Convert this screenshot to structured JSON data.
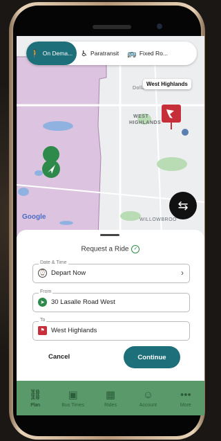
{
  "mode_tabs": [
    {
      "label": "On Dema...",
      "icon": "walking-person-icon"
    },
    {
      "label": "Paratransit",
      "icon": "wheelchair-icon"
    },
    {
      "label": "Fixed Ro...",
      "icon": "bus-icon"
    }
  ],
  "map": {
    "labels": {
      "dollarama": "Dollarama",
      "west": "WEST",
      "highlands": "HIGHLANDS",
      "willowbrook": "WILLOWBROO"
    },
    "destination_callout": "West Highlands",
    "attribution": "Google"
  },
  "sheet": {
    "title": "Request a Ride",
    "date_time": {
      "label": "Date & Time",
      "value": "Depart Now"
    },
    "from": {
      "label": "From",
      "value": "30 Lasalle Road West"
    },
    "to": {
      "label": "To",
      "value": "West Highlands"
    },
    "cancel": "Cancel",
    "continue": "Continue"
  },
  "nav": [
    {
      "label": "Plan",
      "icon": "route-icon"
    },
    {
      "label": "Bus Times",
      "icon": "bus-icon"
    },
    {
      "label": "Rides",
      "icon": "calendar-icon"
    },
    {
      "label": "Account",
      "icon": "person-icon"
    },
    {
      "label": "More",
      "icon": "more-icon"
    }
  ],
  "colors": {
    "accent": "#1d6f7a",
    "nav_bg": "#5a9a6a",
    "origin": "#2e8a4a",
    "destination": "#c62f3a",
    "zone": "#d9bfdc"
  }
}
